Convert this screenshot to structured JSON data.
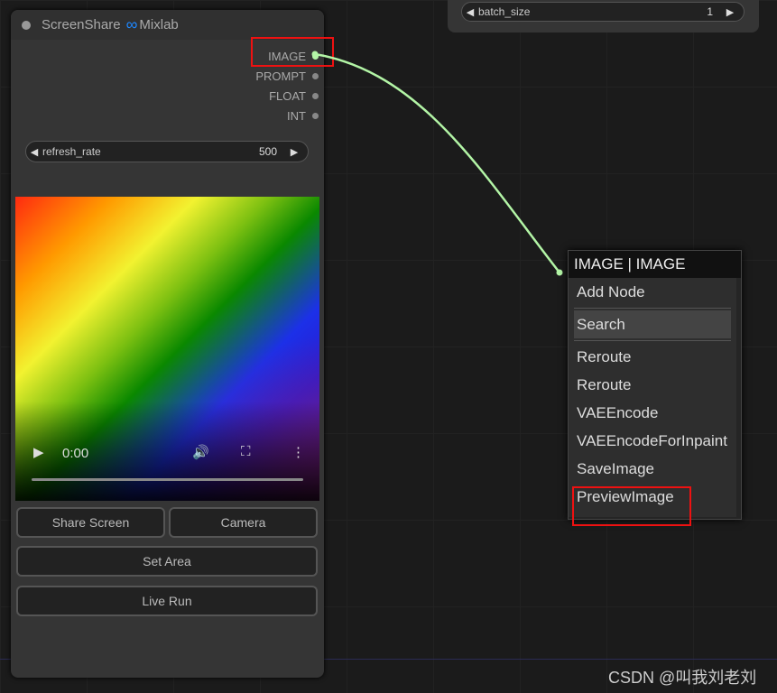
{
  "node": {
    "title": "ScreenShare",
    "badge_icon": "∞",
    "badge_label": "Mixlab",
    "outputs": [
      "IMAGE",
      "PROMPT",
      "FLOAT",
      "INT"
    ],
    "widget": {
      "label": "refresh_rate",
      "value": "500"
    },
    "video": {
      "time": "0:00"
    },
    "buttons": {
      "share": "Share Screen",
      "camera": "Camera",
      "set_area": "Set Area",
      "live_run": "Live Run"
    }
  },
  "batch": {
    "label": "batch_size",
    "value": "1"
  },
  "menu": {
    "title": "IMAGE | IMAGE",
    "items": [
      "Add Node",
      "Search",
      "Reroute",
      "Reroute",
      "VAEEncode",
      "VAEEncodeForInpaint",
      "SaveImage",
      "PreviewImage"
    ]
  },
  "watermark": "CSDN @叫我刘老刘",
  "colors": {
    "link": "#b3f5a6",
    "highlight": "#e11111",
    "accent": "#1e88ff"
  },
  "icons": {
    "play": "play-icon",
    "volume": "volume-icon",
    "fullscreen": "fullscreen-icon",
    "more": "more-icon"
  }
}
